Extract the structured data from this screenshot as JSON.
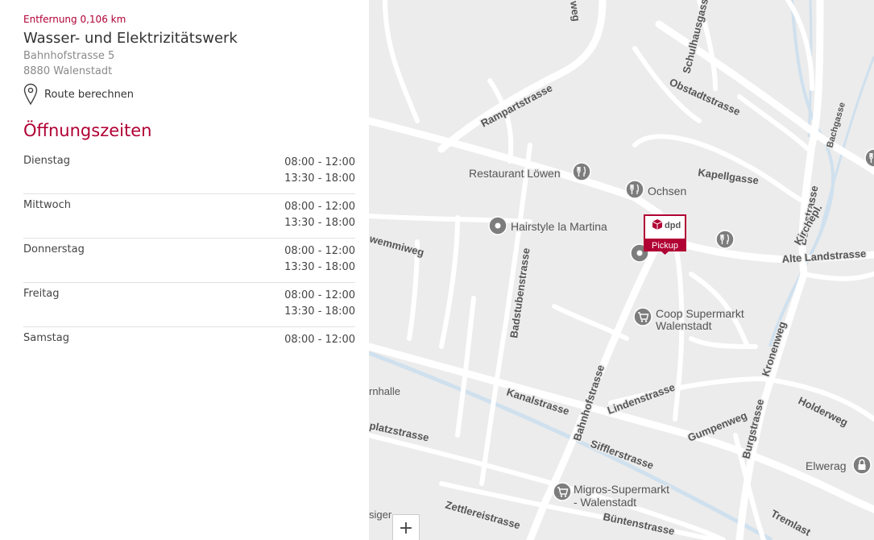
{
  "location": {
    "distance": "Entfernung 0,106 km",
    "name": "Wasser- und Elektrizitätswerk",
    "street": "Bahnhofstrasse 5",
    "city": "8880 Walenstadt",
    "route_label": "Route berechnen"
  },
  "hours": {
    "title": "Öffnungszeiten",
    "days": [
      {
        "day": "Dienstag",
        "times": [
          "08:00 - 12:00",
          "13:30 - 18:00"
        ]
      },
      {
        "day": "Mittwoch",
        "times": [
          "08:00 - 12:00",
          "13:30 - 18:00"
        ]
      },
      {
        "day": "Donnerstag",
        "times": [
          "08:00 - 12:00",
          "13:30 - 18:00"
        ]
      },
      {
        "day": "Freitag",
        "times": [
          "08:00 - 12:00",
          "13:30 - 18:00"
        ]
      },
      {
        "day": "Samstag",
        "times": [
          "08:00 - 12:00"
        ]
      }
    ]
  },
  "map": {
    "zoom_in": "+",
    "marker": {
      "logo": "dpd",
      "label": "Pickup"
    },
    "streets": [
      "weg",
      "Schulhausgasse",
      "Obstadtstrasse",
      "Rampartstrasse",
      "Bachgasse",
      "Kapellgasse",
      "Bergstrasse",
      "Kirchepl.",
      "Alte Landstrasse",
      "wemmiweg",
      "Badstubenstrasse",
      "Kronenweg",
      "rnhalle",
      "Kanalstrasse",
      "Bahnhofstrasse",
      "Lindenstrasse",
      "Holderweg",
      "platzstrasse",
      "Sifflerstrasse",
      "Gumpenweg",
      "Burgstrasse",
      "Zettlereistrasse",
      "Büntenstrasse",
      "Tremlast",
      "siger"
    ],
    "pois": [
      "Restaurant Löwen",
      "Ochsen",
      "Hairstyle la Martina",
      "Coop Supermarkt",
      "Walenstadt",
      "Migros-Supermarkt",
      "- Walenstadt",
      "Elwerag"
    ],
    "icons": [
      "restaurant-icon",
      "place-icon",
      "shopping-cart-icon",
      "lock-icon",
      "dpd-cube-icon"
    ]
  }
}
